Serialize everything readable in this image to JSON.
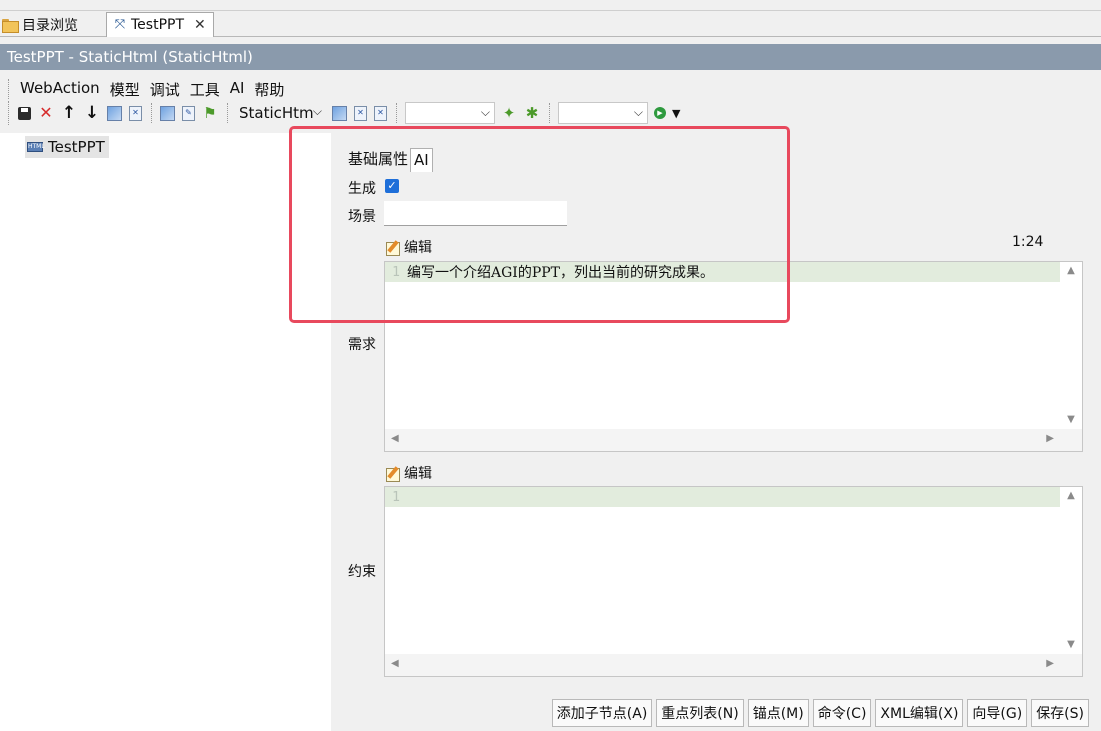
{
  "tabs": [
    {
      "label": "目录浏览",
      "icon": "folder-icon",
      "active": false
    },
    {
      "label": "TestPPT",
      "icon": "gear-x-icon",
      "active": true,
      "close": "✕"
    }
  ],
  "title_band": "TestPPT - StaticHtml  (StaticHtml)",
  "menu": [
    "WebAction",
    "模型",
    "调试",
    "工具",
    "AI",
    "帮助"
  ],
  "toolbar": {
    "type_combo": "StaticHtm",
    "combo2": "",
    "combo3": ""
  },
  "tree": {
    "root": "TestPPT",
    "root_icon": "html-icon"
  },
  "panel": {
    "tabs": [
      "基础属性",
      "AI"
    ],
    "active_tab": "AI",
    "generate_label": "生成",
    "generate_checked": true,
    "scene_label": "场景",
    "scene_value": "",
    "edit_label": "编辑",
    "cursor_pos": "1:24",
    "requirement_label": "需求",
    "requirement_line_no": "1",
    "requirement_text": "编写一个介绍AGI的PPT，列出当前的研究成果。",
    "constraint_label": "约束",
    "constraint_line_no": "1",
    "constraint_text": ""
  },
  "buttons": [
    "添加子节点(A)",
    "重点列表(N)",
    "锚点(M)",
    "命令(C)",
    "XML编辑(X)",
    "向导(G)",
    "保存(S)"
  ],
  "highlight_color": "#e8495d"
}
